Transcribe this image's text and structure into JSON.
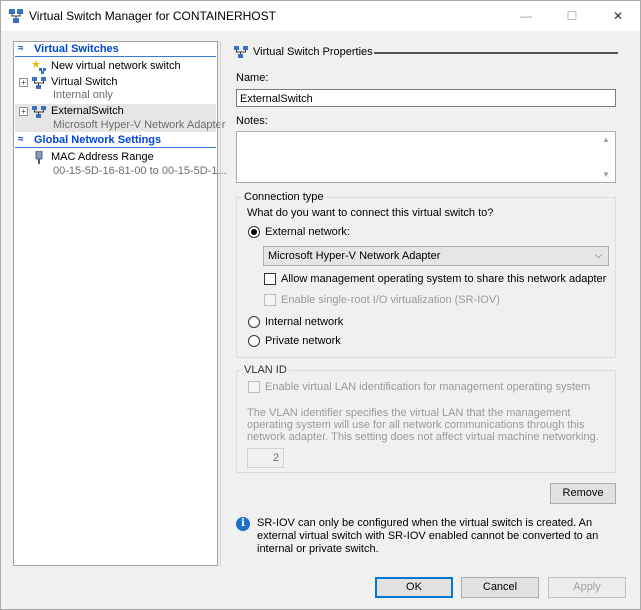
{
  "window": {
    "title": "Virtual Switch Manager for CONTAINERHOST",
    "minimize": "—",
    "maximize": "☐",
    "close": "✕"
  },
  "left_pane": {
    "sections": [
      {
        "title": "Virtual Switches",
        "collapse_glyph": "≈"
      },
      {
        "title": "Global Network Settings",
        "collapse_glyph": "≈"
      }
    ],
    "items": [
      {
        "label": "New virtual network switch",
        "sublabel": ""
      },
      {
        "label": "Virtual Switch",
        "sublabel": "Internal only",
        "expander": "+"
      },
      {
        "label": "ExternalSwitch",
        "sublabel": "Microsoft Hyper-V Network Adapter",
        "expander": "+"
      },
      {
        "label": "MAC Address Range",
        "sublabel": "00-15-5D-16-81-00 to 00-15-5D-1..."
      }
    ]
  },
  "properties": {
    "header": "Virtual Switch Properties",
    "name_label": "Name:",
    "name_value": "ExternalSwitch",
    "notes_label": "Notes:",
    "notes_value": "",
    "connection_type": {
      "title": "Connection type",
      "question": "What do you want to connect this virtual switch to?",
      "external_label": "External network:",
      "adapter_selected": "Microsoft Hyper-V Network Adapter",
      "allow_mgmt_label": "Allow management operating system to share this network adapter",
      "sriov_label": "Enable single-root I/O virtualization (SR-IOV)",
      "internal_label": "Internal network",
      "private_label": "Private network"
    },
    "vlan": {
      "title": "VLAN ID",
      "enable_label": "Enable virtual LAN identification for management operating system",
      "description": "The VLAN identifier specifies the virtual LAN that the management operating system will use for all network communications through this network adapter. This setting does not affect virtual machine networking.",
      "value": "2"
    },
    "remove_label": "Remove",
    "info_text": "SR-IOV can only be configured when the virtual switch is created. An external virtual switch with SR-IOV enabled cannot be converted to an internal or private switch."
  },
  "footer": {
    "ok": "OK",
    "cancel": "Cancel",
    "apply": "Apply"
  },
  "colors": {
    "accent": "#0046d5",
    "button_focus": "#0078d7",
    "info": "#1f6fc5"
  }
}
